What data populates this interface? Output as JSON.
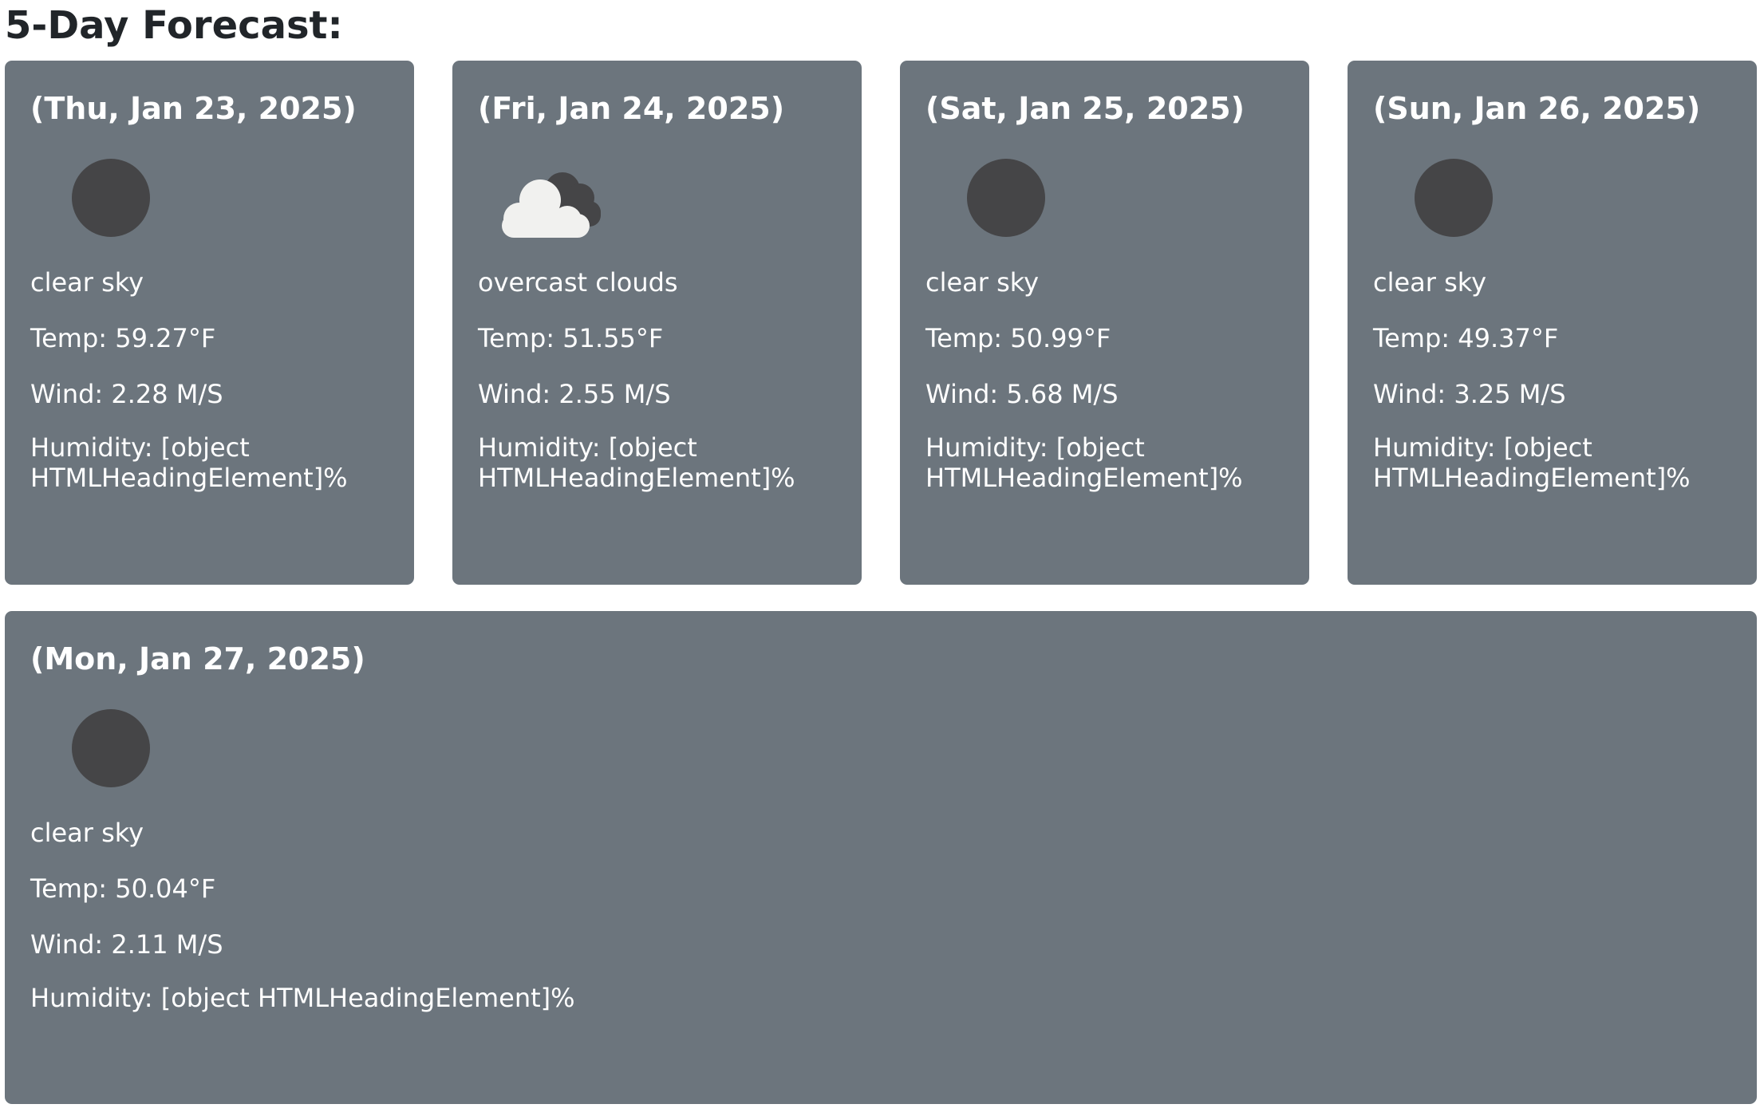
{
  "page": {
    "title": "5-Day Forecast:"
  },
  "colors": {
    "card_bg": "#6c757d",
    "text_dark": "#212529",
    "text_light": "#ffffff",
    "clear_sky_icon": "#454547"
  },
  "forecast": [
    {
      "date": "(Thu, Jan 23, 2025)",
      "icon": "clear-sky-icon",
      "description": "clear sky",
      "temp": "Temp: 59.27°F",
      "wind": "Wind: 2.28 M/S",
      "humidity": "Humidity: [object HTMLHeadingElement]%"
    },
    {
      "date": "(Fri, Jan 24, 2025)",
      "icon": "overcast-clouds-icon",
      "description": "overcast clouds",
      "temp": "Temp: 51.55°F",
      "wind": "Wind: 2.55 M/S",
      "humidity": "Humidity: [object HTMLHeadingElement]%"
    },
    {
      "date": "(Sat, Jan 25, 2025)",
      "icon": "clear-sky-icon",
      "description": "clear sky",
      "temp": "Temp: 50.99°F",
      "wind": "Wind: 5.68 M/S",
      "humidity": "Humidity: [object HTMLHeadingElement]%"
    },
    {
      "date": "(Sun, Jan 26, 2025)",
      "icon": "clear-sky-icon",
      "description": "clear sky",
      "temp": "Temp: 49.37°F",
      "wind": "Wind: 3.25 M/S",
      "humidity": "Humidity: [object HTMLHeadingElement]%"
    },
    {
      "date": "(Mon, Jan 27, 2025)",
      "icon": "clear-sky-icon",
      "description": "clear sky",
      "temp": "Temp: 50.04°F",
      "wind": "Wind: 2.11 M/S",
      "humidity": "Humidity: [object HTMLHeadingElement]%"
    }
  ]
}
